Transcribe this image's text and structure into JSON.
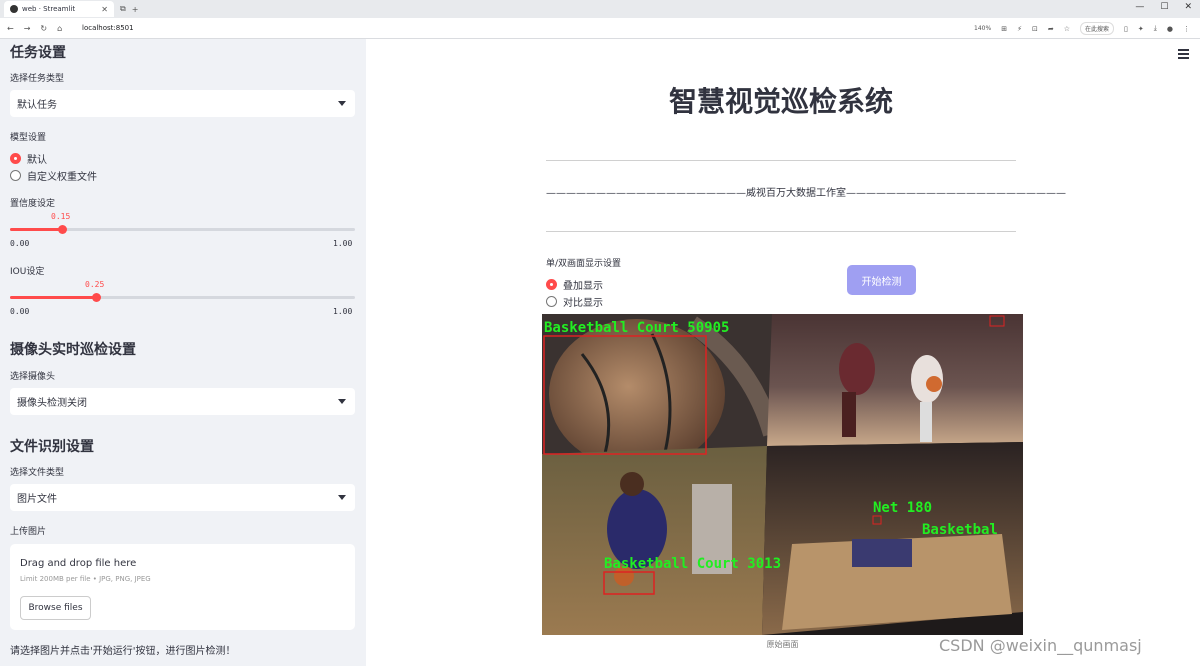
{
  "browser": {
    "tab_title": "web · Streamlit",
    "url": "localhost:8501",
    "zoom": "140%",
    "search_label": "在此搜索"
  },
  "sidebar": {
    "task_section_title": "任务设置",
    "task_type_label": "选择任务类型",
    "task_type_value": "默认任务",
    "model_section_label": "模型设置",
    "model_options": [
      "默认",
      "自定义权重文件"
    ],
    "model_selected": "默认",
    "conf_label": "置信度设定",
    "conf_value": "0.15",
    "conf_fraction": 0.15,
    "conf_min": "0.00",
    "conf_max": "1.00",
    "iou_label": "IOU设定",
    "iou_value": "0.25",
    "iou_fraction": 0.25,
    "iou_min": "0.00",
    "iou_max": "1.00",
    "camera_section_title": "摄像头实时巡检设置",
    "camera_label": "选择摄像头",
    "camera_value": "摄像头检测关闭",
    "file_section_title": "文件识别设置",
    "file_type_label": "选择文件类型",
    "file_type_value": "图片文件",
    "upload_label": "上传图片",
    "upload_title": "Drag and drop file here",
    "upload_limit": "Limit 200MB per file • JPG, PNG, JPEG",
    "browse_label": "Browse files",
    "footer_hint": "请选择图片并点击'开始运行'按钮，进行图片检测！"
  },
  "main": {
    "title": "智慧视觉巡检系统",
    "studio_line": "————————————————————威视百万大数据工作室——————————————————————",
    "display_label": "单/双画面显示设置",
    "display_options": [
      "叠加显示",
      "对比显示"
    ],
    "display_selected": "叠加显示",
    "start_button": "开始检测",
    "image_caption": "原始画面",
    "detections": [
      {
        "label": "Basketball Court 50905"
      },
      {
        "label": "Net 180"
      },
      {
        "label": "Basketbal"
      },
      {
        "label": "Basketball Court 3013"
      }
    ]
  },
  "watermark": "CSDN @weixin__qunmasj",
  "colors": {
    "accent": "#ff4b4b",
    "sidebar_bg": "#f0f2f6",
    "button": "#9f9ff2",
    "detect_text": "#22ee22",
    "detect_box": "#dd2222"
  }
}
